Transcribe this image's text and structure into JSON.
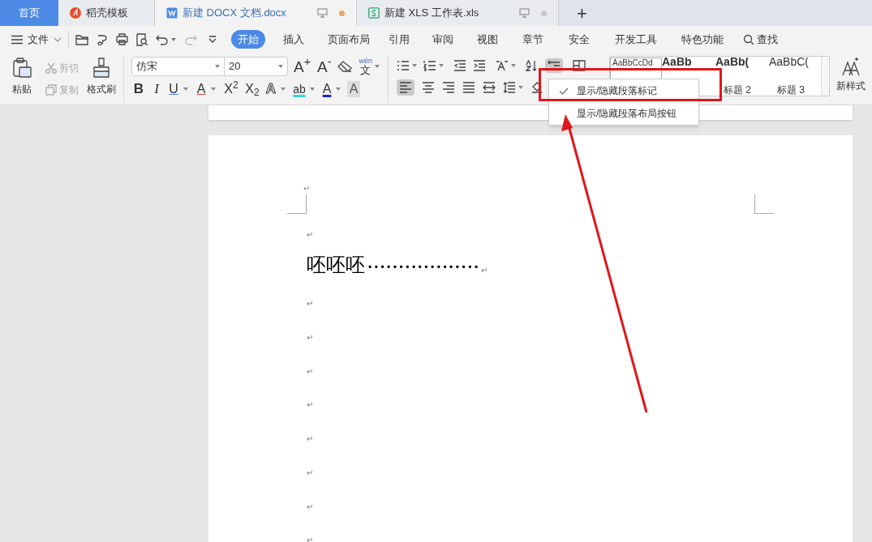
{
  "tabs": [
    {
      "kind": "home",
      "label": "首页",
      "selected": false
    },
    {
      "kind": "template",
      "label": "稻壳模板",
      "selected": false
    },
    {
      "kind": "docx",
      "label": "新建 DOCX 文档.docx",
      "selected": true,
      "unsaved": true
    },
    {
      "kind": "xls",
      "label": "新建 XLS 工作表.xls",
      "selected": false,
      "unsaved": false
    }
  ],
  "new_tab": "+",
  "file_menu": "文件",
  "ribbon_tabs": [
    {
      "label": "开始",
      "selected": true
    },
    {
      "label": "插入",
      "selected": false
    },
    {
      "label": "页面布局",
      "selected": false
    },
    {
      "label": "引用",
      "selected": false
    },
    {
      "label": "审阅",
      "selected": false
    },
    {
      "label": "视图",
      "selected": false
    },
    {
      "label": "章节",
      "selected": false
    },
    {
      "label": "安全",
      "selected": false
    },
    {
      "label": "开发工具",
      "selected": false
    },
    {
      "label": "特色功能",
      "selected": false
    }
  ],
  "search": "查找",
  "clipboard": [
    {
      "label": "粘贴",
      "disabled": false
    },
    {
      "label": "剪切",
      "disabled": true
    },
    {
      "label": "复制",
      "disabled": true
    },
    {
      "label": "格式刷",
      "disabled": false
    }
  ],
  "font": {
    "name": "仿宋",
    "size": "20",
    "grow": "A$^{+}$",
    "shrink": "A$^{-}$",
    "phonetic_ruby": "wén",
    "phonetic_base": "文"
  },
  "font_buttons": [
    {
      "kind": "bold",
      "label": "B"
    },
    {
      "kind": "italic",
      "label": "I"
    },
    {
      "kind": "underline",
      "label": "U"
    },
    {
      "kind": "strike",
      "label": "A"
    },
    {
      "kind": "plain",
      "label": "X$^{2}$"
    },
    {
      "kind": "plain",
      "label": "X$_{2}$"
    },
    {
      "kind": "outline",
      "label": "A"
    },
    {
      "kind": "highlight",
      "label": "ab"
    },
    {
      "kind": "fontcolor",
      "label": "A"
    },
    {
      "kind": "shade",
      "label": "A"
    }
  ],
  "paragraph_marks_on": true,
  "styles": [
    {
      "preview": "AaBbCcDd"
    },
    {
      "preview": "AaBb"
    },
    {
      "preview": "AaBb(",
      "label": "标题 2"
    },
    {
      "preview": "AaBbC(",
      "label": "标题 3"
    }
  ],
  "new_style": "新样式",
  "dropdown": [
    {
      "label": "显示/隐藏段落标记",
      "checked": true
    },
    {
      "label": "显示/隐藏段落布局按钮",
      "checked": false
    }
  ],
  "document": {
    "top_mark": "↵",
    "paragraphs": [
      {
        "kind": "empty",
        "mark": "↵"
      },
      {
        "kind": "text",
        "text": "呸呸呸",
        "leader": "••••••••••••••••••",
        "mark": "↵"
      },
      {
        "kind": "empty",
        "mark": "↵"
      },
      {
        "kind": "empty",
        "mark": "↵"
      },
      {
        "kind": "empty",
        "mark": "↵"
      },
      {
        "kind": "empty",
        "mark": "↵"
      },
      {
        "kind": "empty",
        "mark": "↵"
      },
      {
        "kind": "empty",
        "mark": "↵"
      },
      {
        "kind": "empty",
        "mark": "↵"
      },
      {
        "kind": "empty",
        "mark": "↵"
      }
    ]
  }
}
